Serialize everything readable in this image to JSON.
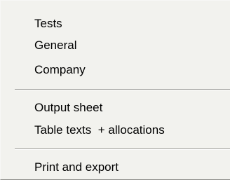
{
  "menu": {
    "group1": [
      "Tests",
      "General",
      "Company"
    ],
    "group2": [
      "Output sheet",
      "Table texts  + allocations"
    ],
    "group3": [
      "Print and export"
    ]
  }
}
